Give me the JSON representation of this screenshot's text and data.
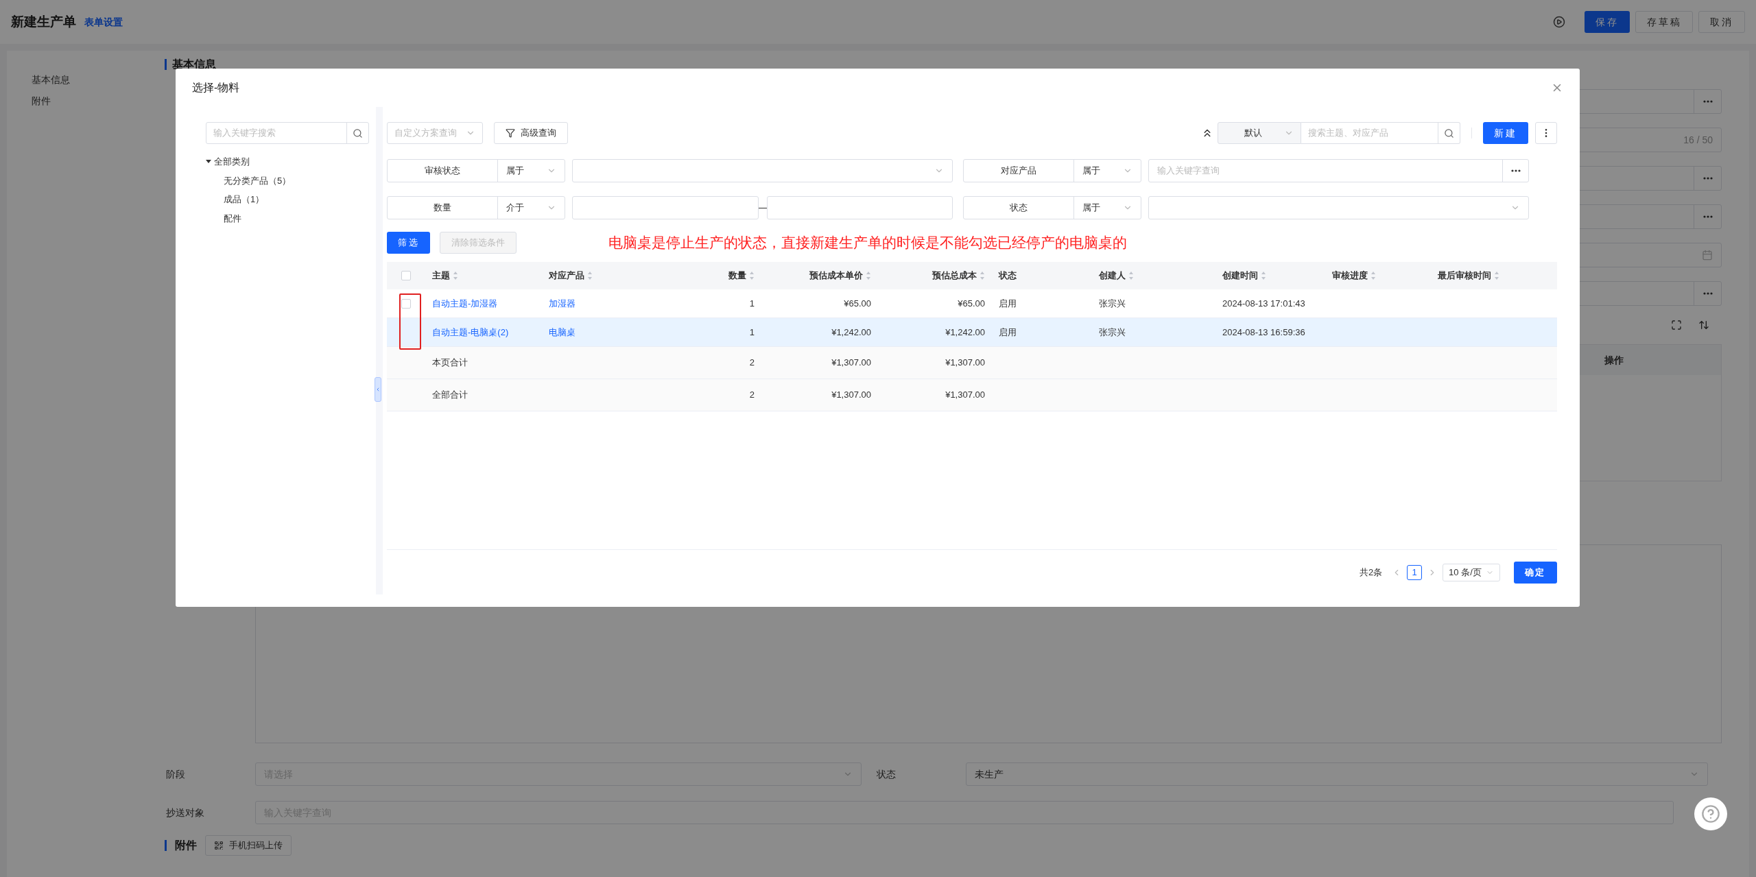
{
  "page": {
    "title": "新建生产单",
    "settings_link": "表单设置",
    "actions": [
      {
        "label": "保存",
        "kind": "primary"
      },
      {
        "label": "存草稿",
        "kind": "default"
      },
      {
        "label": "取消",
        "kind": "default"
      }
    ],
    "nav": [
      "基本信息",
      "附件"
    ],
    "section_title": "基本信息",
    "form_rows": [
      {
        "kind": "more"
      },
      {
        "kind": "counter",
        "counter": "16 / 50"
      },
      {
        "kind": "more"
      },
      {
        "kind": "more"
      },
      {
        "kind": "date"
      },
      {
        "kind": "more"
      }
    ],
    "detail_table": {
      "columns": [
        "操作"
      ]
    },
    "bottom_fields": [
      {
        "label": "阶段",
        "placeholder": "请选择"
      },
      {
        "label": "状态",
        "value": "未生产"
      }
    ],
    "cc": {
      "label": "抄送对象",
      "placeholder": "输入关键字查询"
    },
    "attachments": {
      "title": "附件",
      "upload_button": "手机扫码上传"
    }
  },
  "dialog": {
    "title": "选择-物料",
    "tree": {
      "search_placeholder": "输入关键字搜索",
      "root": {
        "label": "全部类别",
        "expanded": true,
        "children": [
          {
            "label": "无分类产品（5）"
          },
          {
            "label": "成品（1）"
          },
          {
            "label": "配件"
          }
        ]
      }
    },
    "toolbar": {
      "scheme_placeholder": "自定义方案查询",
      "advanced": "高级查询",
      "view": "默认",
      "search_placeholder": "搜索主题、对应产品",
      "new_button": "新建"
    },
    "filters": [
      {
        "field": "审核状态",
        "operator": "属于",
        "kind": "select"
      },
      {
        "field": "对应产品",
        "operator": "属于",
        "kind": "lookup",
        "placeholder": "输入关键字查询"
      },
      {
        "field": "数量",
        "operator": "介于",
        "kind": "range"
      },
      {
        "field": "状态",
        "operator": "属于",
        "kind": "select"
      }
    ],
    "filter_button": "筛选",
    "clear_button": {
      "label": "清除筛选条件",
      "disabled": true
    },
    "annotation": "电脑桌是停止生产的状态，直接新建生产单的时候是不能勾选已经停产的电脑桌的",
    "table": {
      "header_checked": false,
      "columns": [
        {
          "label": "主题",
          "sortable": true
        },
        {
          "label": "对应产品",
          "sortable": true
        },
        {
          "label": "数量",
          "sortable": true
        },
        {
          "label": "预估成本单价",
          "sortable": true
        },
        {
          "label": "预估总成本",
          "sortable": true
        },
        {
          "label": "状态",
          "sortable": false
        },
        {
          "label": "创建人",
          "sortable": true
        },
        {
          "label": "创建时间",
          "sortable": true
        },
        {
          "label": "审核进度",
          "sortable": true
        },
        {
          "label": "最后审核时间",
          "sortable": true
        }
      ],
      "rows": [
        {
          "kind": "item",
          "selectable": true,
          "checked": false,
          "highlighted": false,
          "cells": [
            "自动主题-加湿器",
            "加湿器",
            "1",
            "¥65.00",
            "¥65.00",
            "启用",
            "张宗兴",
            "2024-08-13 17:01:43"
          ]
        },
        {
          "kind": "item",
          "selectable": false,
          "highlighted": true,
          "cells": [
            "自动主题-电脑桌(2)",
            "电脑桌",
            "1",
            "¥1,242.00",
            "¥1,242.00",
            "启用",
            "张宗兴",
            "2024-08-13 16:59:36"
          ]
        },
        {
          "kind": "total",
          "cells": [
            "本页合计",
            null,
            "2",
            "¥1,307.00",
            "¥1,307.00"
          ]
        },
        {
          "kind": "total",
          "cells": [
            "全部合计",
            null,
            "2",
            "¥1,307.00",
            "¥1,307.00"
          ]
        }
      ]
    },
    "footer": {
      "total": "共2条",
      "pages": [
        {
          "label": "1",
          "selected": true
        }
      ],
      "page_size": "10 条/页",
      "confirm": "确定"
    }
  }
}
